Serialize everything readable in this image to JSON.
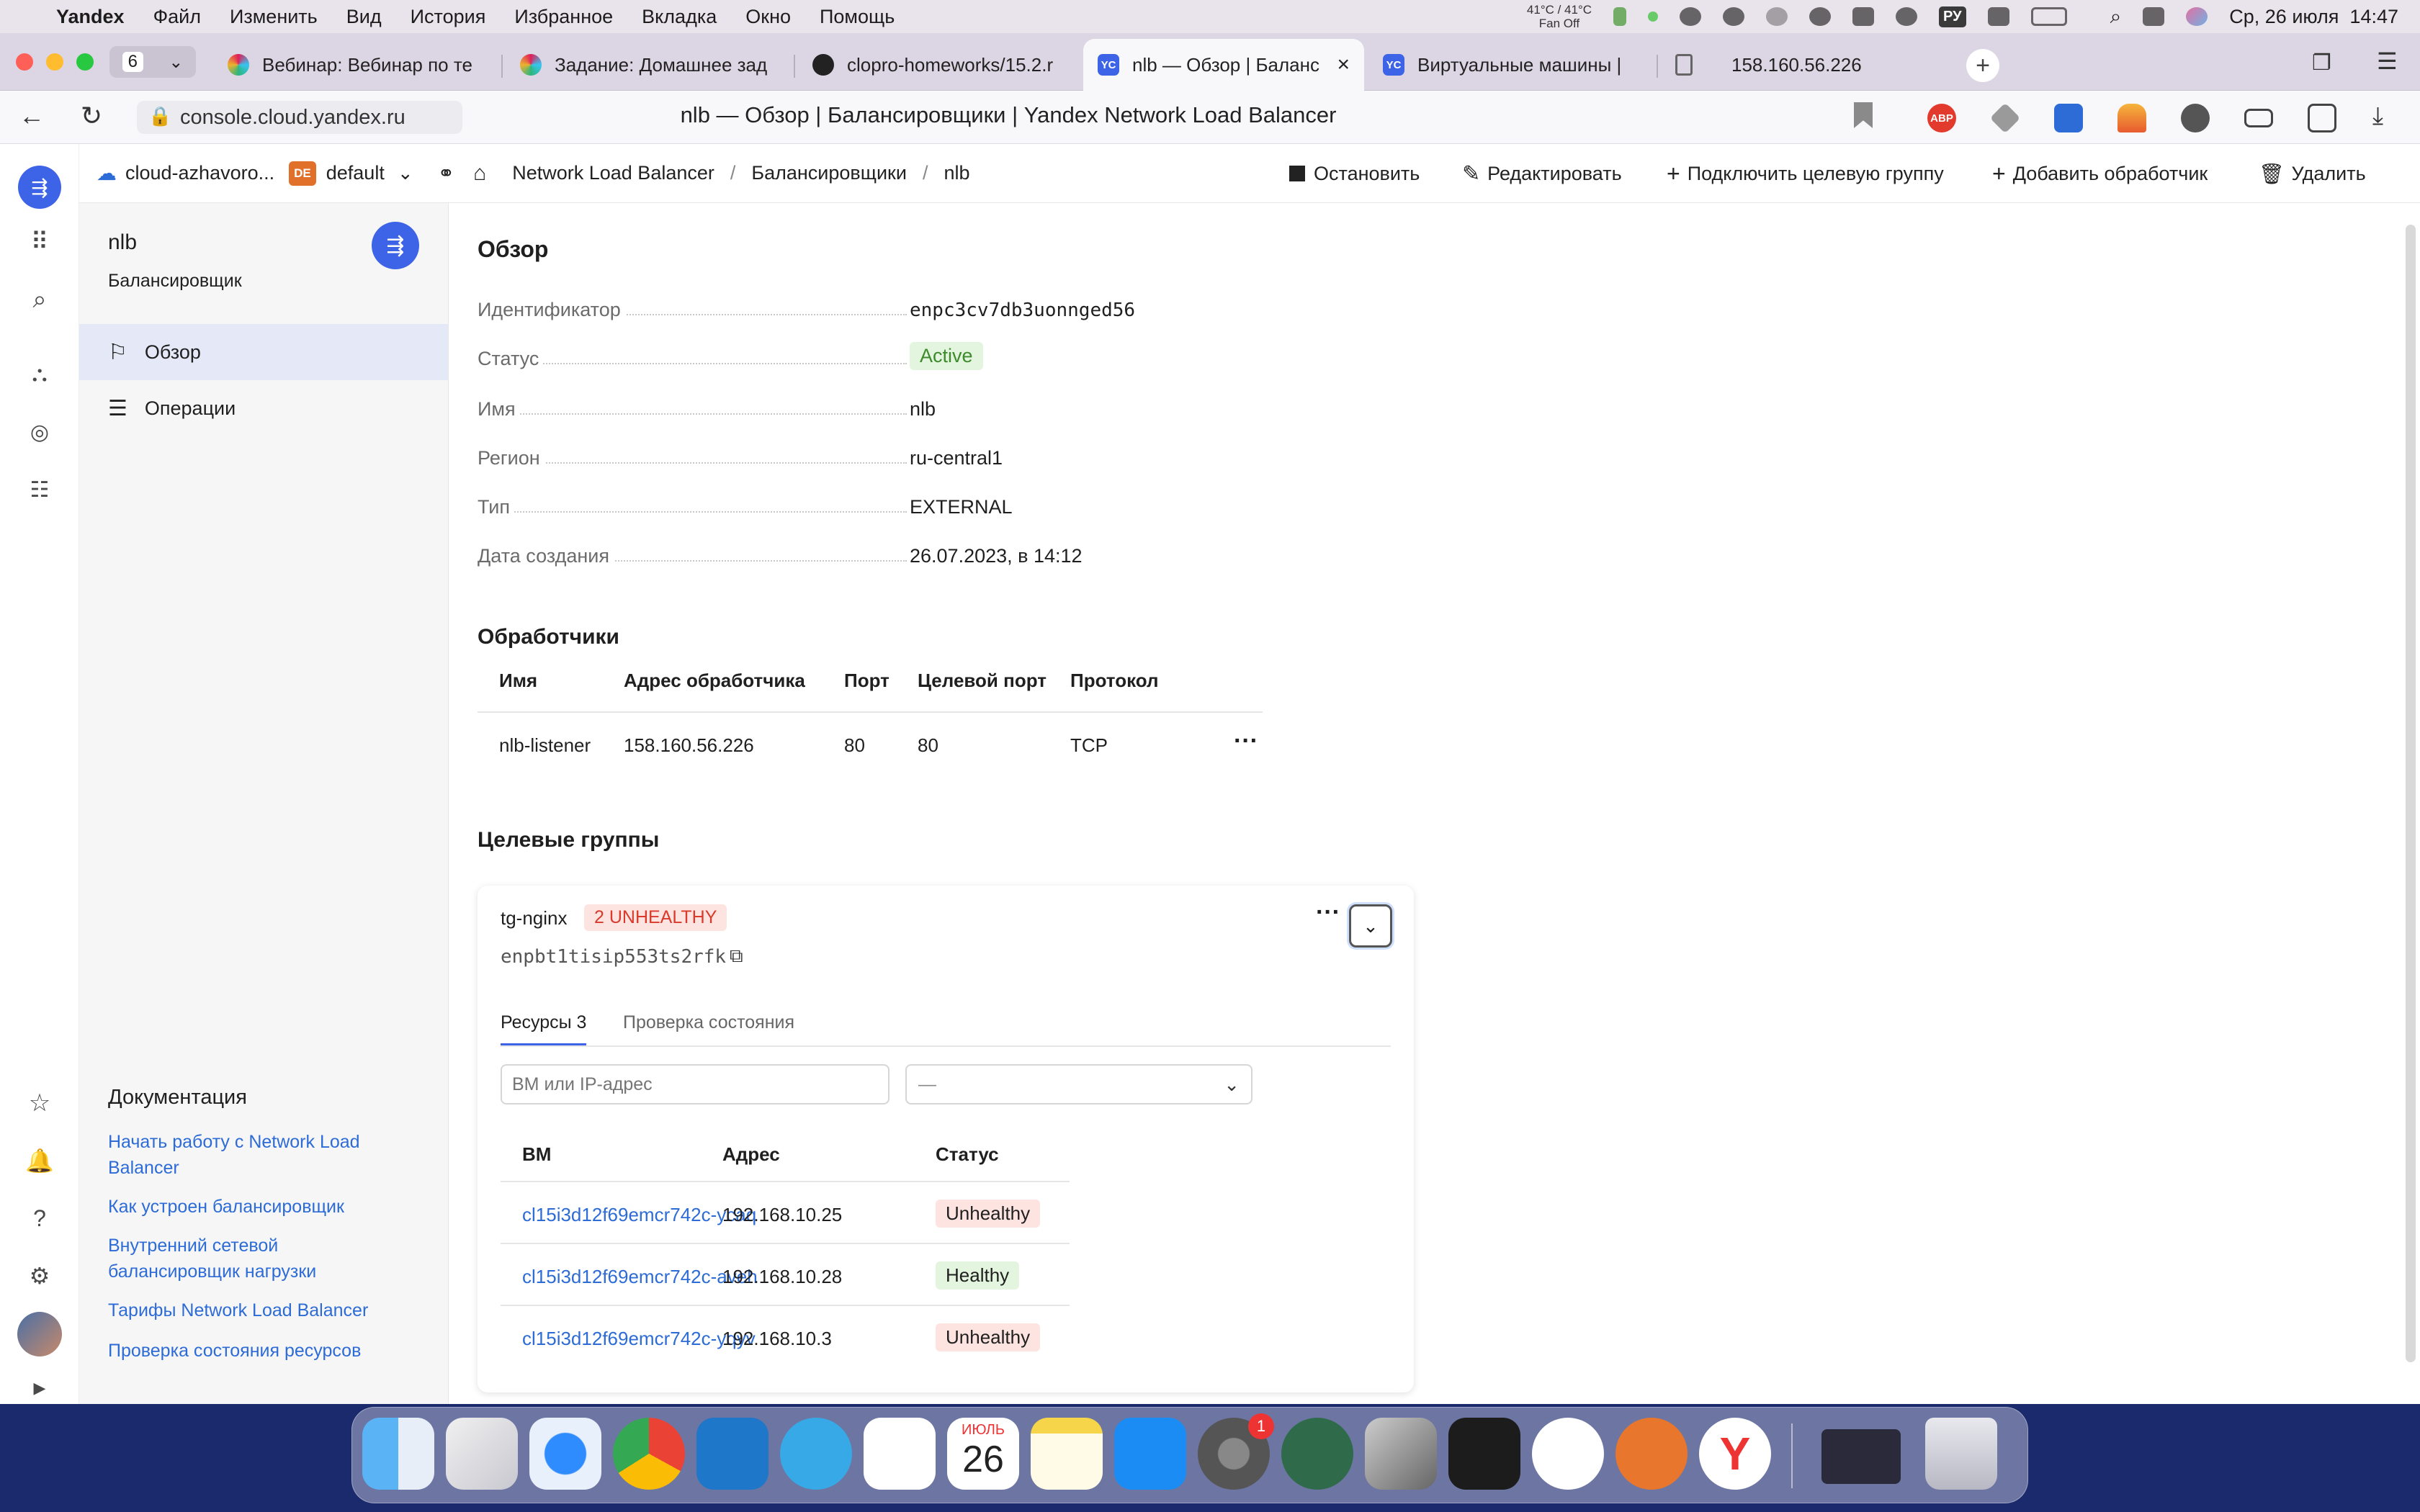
{
  "menubar": {
    "app": "Yandex",
    "items": [
      "Файл",
      "Изменить",
      "Вид",
      "История",
      "Избранное",
      "Вкладка",
      "Окно",
      "Помощь"
    ],
    "temp_line1": "41°C / 41°C",
    "temp_line2": "Fan Off",
    "input_source": "РУ",
    "datetime": "Ср, 26 июля  14:47"
  },
  "browser": {
    "tab_count": "6",
    "tabs": [
      {
        "title": "Вебинар: Вебинар по те",
        "icon": "slack-icon",
        "color": "#7c3aed"
      },
      {
        "title": "Задание: Домашнее зад",
        "icon": "slack-icon",
        "color": "#7c3aed"
      },
      {
        "title": "clopro-homeworks/15.2.r",
        "icon": "github-icon",
        "color": "#222222"
      },
      {
        "title": "nlb — Обзор | Баланс",
        "icon": "yc-icon",
        "color": "#3d63e6",
        "active": true
      },
      {
        "title": "Виртуальные машины |",
        "icon": "yc-icon",
        "color": "#3d63e6"
      },
      {
        "title": "158.160.56.226",
        "icon": "document-icon",
        "color": "#666666"
      }
    ],
    "yc_badge": "YC",
    "url": "console.cloud.yandex.ru",
    "page_title": "nlb — Обзор | Балансировщики | Yandex Network Load Balancer",
    "abp": "ABP"
  },
  "topnav": {
    "cloud": "cloud-azhavoro...",
    "folder_badge": "DE",
    "folder": "default",
    "breadcrumbs": [
      "Network Load Balancer",
      "Балансировщики",
      "nlb"
    ],
    "separator": "/",
    "actions": {
      "stop": "Остановить",
      "edit": "Редактировать",
      "attach": "Подключить целевую группу",
      "add_listener": "Добавить обработчик",
      "delete": "Удалить"
    }
  },
  "sidebar": {
    "title": "nlb",
    "subtitle": "Балансировщик",
    "nav": [
      {
        "label": "Обзор",
        "active": true
      },
      {
        "label": "Операции",
        "active": false
      }
    ],
    "docs_title": "Документация",
    "docs": [
      "Начать работу с Network Load Balancer",
      "Как устроен балансировщик",
      "Внутренний сетевой балансировщик нагрузки",
      "Тарифы Network Load Balancer",
      "Проверка состояния ресурсов"
    ]
  },
  "overview": {
    "title": "Обзор",
    "fields": [
      {
        "key": "Идентификатор",
        "value": "enpc3cv7db3uonnged56"
      },
      {
        "key": "Статус",
        "value": "Active"
      },
      {
        "key": "Имя",
        "value": "nlb"
      },
      {
        "key": "Регион",
        "value": "ru-central1"
      },
      {
        "key": "Тип",
        "value": "EXTERNAL"
      },
      {
        "key": "Дата создания",
        "value": "26.07.2023, в 14:12"
      }
    ]
  },
  "listeners": {
    "title": "Обработчики",
    "columns": [
      "Имя",
      "Адрес обработчика",
      "Порт",
      "Целевой порт",
      "Протокол"
    ],
    "rows": [
      [
        "nlb-listener",
        "158.160.56.226",
        "80",
        "80",
        "TCP"
      ]
    ]
  },
  "target_groups": {
    "title": "Целевые группы",
    "group": {
      "name": "tg-nginx",
      "badge": "2 UNHEALTHY",
      "id": "enpbt1tisip553ts2rfk",
      "tabs": [
        "Ресурсы 3",
        "Проверка состояния"
      ],
      "search_placeholder": "ВМ или IP-адрес",
      "select_value": "—",
      "columns": [
        "ВМ",
        "Адрес",
        "Статус"
      ],
      "rows": [
        {
          "vm": "cl15i3d12f69emcr742c-ycaq",
          "addr": "192.168.10.25",
          "status": "Unhealthy"
        },
        {
          "vm": "cl15i3d12f69emcr742c-aveh",
          "addr": "192.168.10.28",
          "status": "Healthy"
        },
        {
          "vm": "cl15i3d12f69emcr742c-yqyv",
          "addr": "192.168.10.3",
          "status": "Unhealthy"
        }
      ]
    }
  },
  "dock": {
    "calendar_month": "ИЮЛЬ",
    "calendar_day": "26",
    "settings_badge": "1"
  },
  "colors": {
    "accent": "#3d63e6",
    "link": "#2d6bd6",
    "healthy": "#3d8c2b",
    "unhealthy": "#d93a2b"
  }
}
